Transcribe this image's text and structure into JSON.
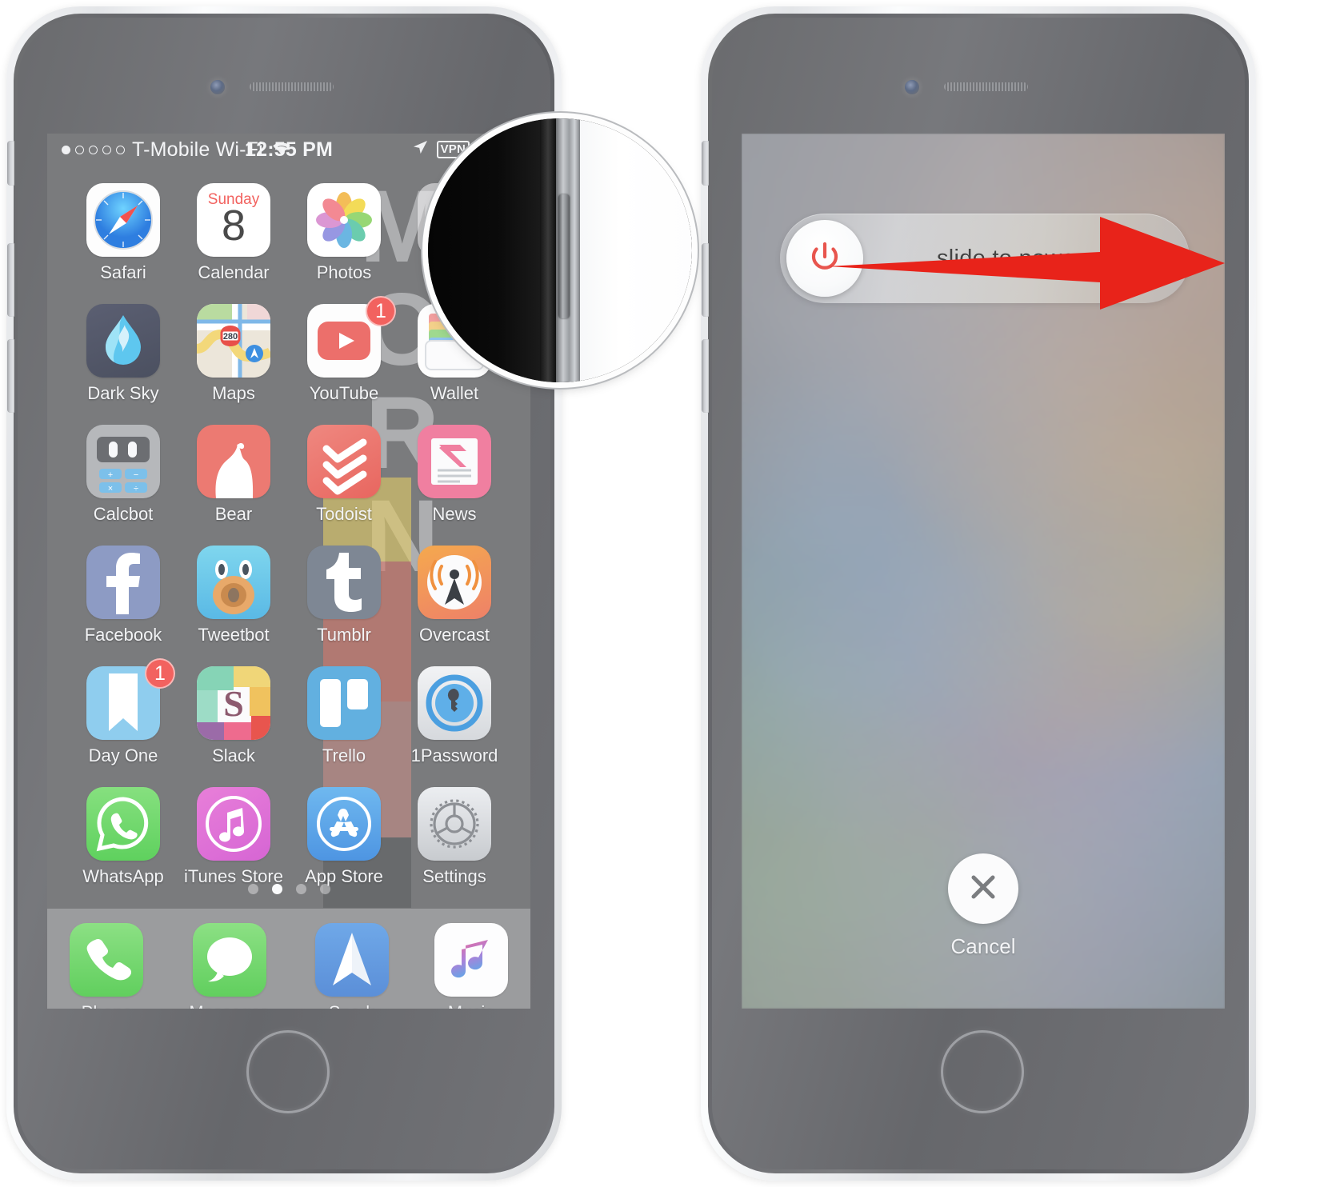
{
  "meta": {
    "accent_red": "#e8231a",
    "badge_red": "#f2625f",
    "phone_body": "#6e6f72",
    "wallpaper_letters": "MORN"
  },
  "left_phone": {
    "name": "iphone-home-screen",
    "status_bar": {
      "carrier": "T-Mobile Wi-Fi",
      "signal_dots": [
        true,
        false,
        false,
        false,
        false
      ],
      "wifi_icon": "wifi-icon",
      "time": "12:55 PM",
      "location_icon": "location-arrow-icon",
      "vpn_label": "VPN",
      "headphones_icon": "headphones-icon",
      "battery_icon": "battery-icon"
    },
    "rows": [
      [
        {
          "label": "Safari",
          "icon": "safari-icon"
        },
        {
          "label": "Calendar",
          "icon": "calendar-icon",
          "day": "Sunday",
          "date": "8"
        },
        {
          "label": "Photos",
          "icon": "photos-icon"
        },
        {
          "label": "",
          "icon": "hidden-icon"
        }
      ],
      [
        {
          "label": "Dark Sky",
          "icon": "dark-sky-icon"
        },
        {
          "label": "Maps",
          "icon": "maps-icon",
          "route": "280"
        },
        {
          "label": "YouTube",
          "icon": "youtube-icon",
          "badge": "1"
        },
        {
          "label": "Wallet",
          "icon": "wallet-icon"
        }
      ],
      [
        {
          "label": "Calcbot",
          "icon": "calcbot-icon"
        },
        {
          "label": "Bear",
          "icon": "bear-icon"
        },
        {
          "label": "Todoist",
          "icon": "todoist-icon"
        },
        {
          "label": "News",
          "icon": "news-icon"
        }
      ],
      [
        {
          "label": "Facebook",
          "icon": "facebook-icon"
        },
        {
          "label": "Tweetbot",
          "icon": "tweetbot-icon"
        },
        {
          "label": "Tumblr",
          "icon": "tumblr-icon"
        },
        {
          "label": "Overcast",
          "icon": "overcast-icon"
        }
      ],
      [
        {
          "label": "Day One",
          "icon": "day-one-icon",
          "badge": "1"
        },
        {
          "label": "Slack",
          "icon": "slack-icon"
        },
        {
          "label": "Trello",
          "icon": "trello-icon"
        },
        {
          "label": "1Password",
          "icon": "onepassword-icon"
        }
      ],
      [
        {
          "label": "WhatsApp",
          "icon": "whatsapp-icon"
        },
        {
          "label": "iTunes Store",
          "icon": "itunes-store-icon"
        },
        {
          "label": "App Store",
          "icon": "app-store-icon"
        },
        {
          "label": "Settings",
          "icon": "settings-icon"
        }
      ]
    ],
    "page_dots": {
      "count": 4,
      "active_index": 1
    },
    "dock": [
      {
        "label": "Phone",
        "icon": "phone-icon"
      },
      {
        "label": "Messages",
        "icon": "messages-icon"
      },
      {
        "label": "Spark",
        "icon": "spark-icon"
      },
      {
        "label": "Music",
        "icon": "music-icon"
      }
    ]
  },
  "magnifier": {
    "name": "side-button-magnifier",
    "depicts": "iphone-sleep-wake-side-button"
  },
  "right_phone": {
    "name": "iphone-power-off-screen",
    "slider": {
      "text": "slide to power off",
      "knob_icon": "power-icon"
    },
    "cancel": {
      "label": "Cancel",
      "icon": "close-x-icon"
    },
    "annotation_arrow": {
      "name": "slide-right-arrow",
      "direction": "right",
      "color": "#e8231a"
    }
  }
}
